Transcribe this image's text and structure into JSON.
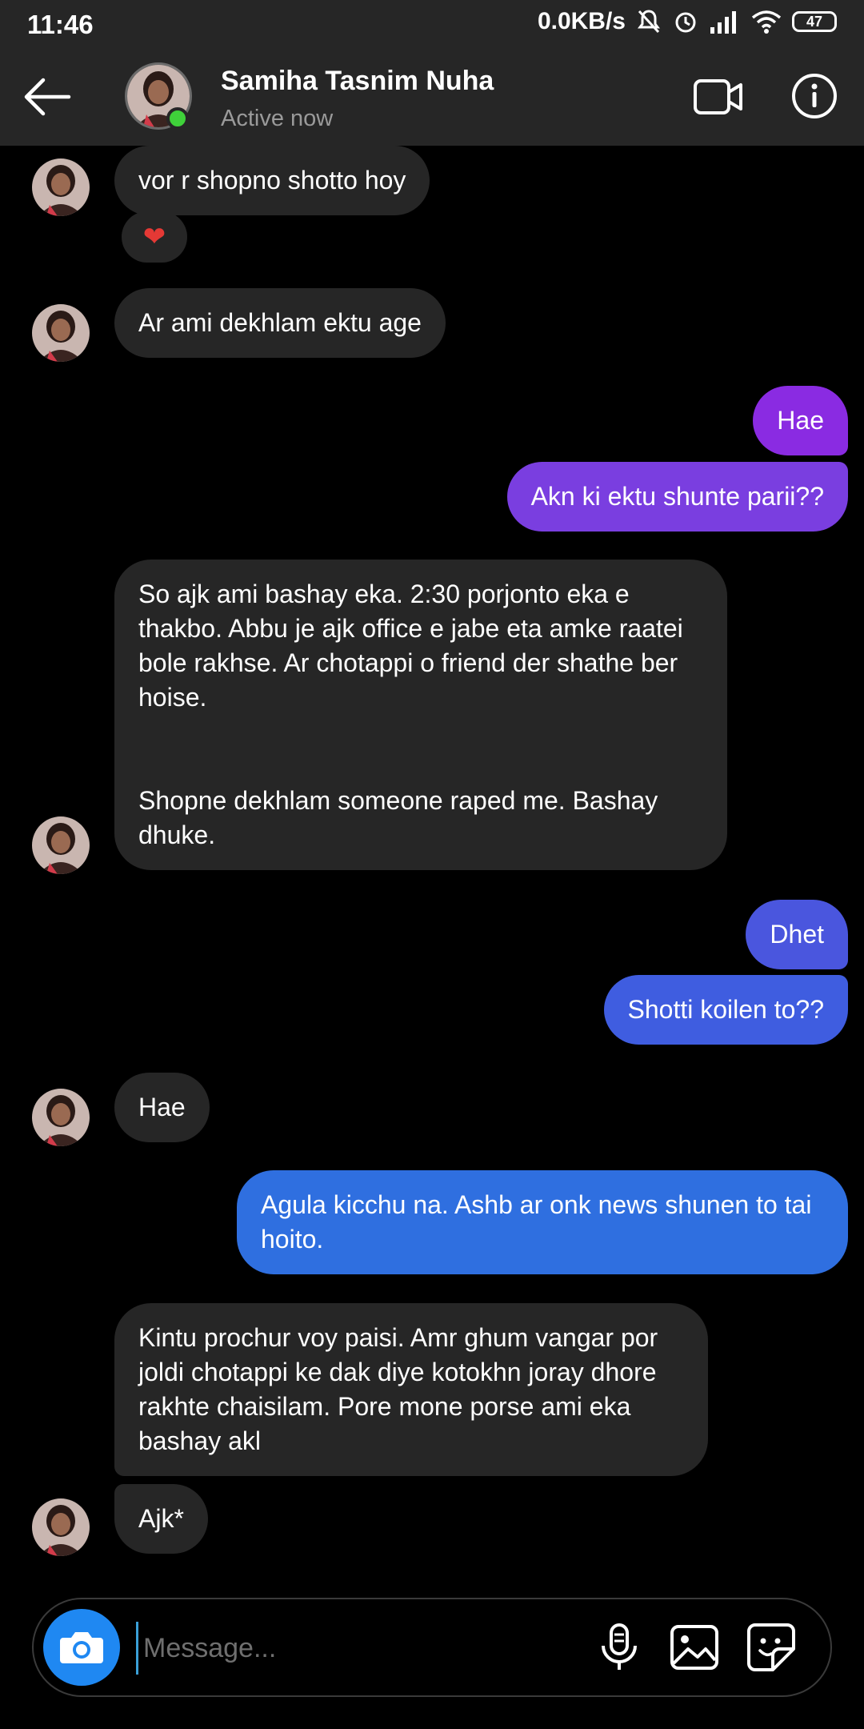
{
  "status_bar": {
    "time": "11:46",
    "speed": "0.0KB/s",
    "battery": "47"
  },
  "header": {
    "name": "Samiha Tasnim Nuha",
    "status": "Active now"
  },
  "messages": [
    {
      "side": "in",
      "text": "vor r shopno shotto hoy",
      "reaction": "❤"
    },
    {
      "side": "in",
      "text": "Ar ami dekhlam ektu age"
    },
    {
      "side": "out",
      "text": "Hae"
    },
    {
      "side": "out",
      "text": "Akn ki ektu shunte parii??"
    },
    {
      "side": "in",
      "text": "So ajk ami bashay eka. 2:30 porjonto eka e thakbo. Abbu je ajk office e jabe eta amke raatei bole rakhse. Ar chotappi o friend der shathe ber hoise.\n\n\nShopne dekhlam someone raped me. Bashay dhuke."
    },
    {
      "side": "out",
      "text": "Dhet"
    },
    {
      "side": "out",
      "text": "Shotti koilen to??"
    },
    {
      "side": "in",
      "text": "Hae"
    },
    {
      "side": "out",
      "text": "Agula kicchu na. Ashb ar onk news shunen to tai hoito."
    },
    {
      "side": "in",
      "text": "Kintu prochur voy paisi. Amr ghum vangar por joldi chotappi ke dak diye kotokhn joray dhore rakhte chaisilam. Pore mone porse ami eka bashay akl"
    },
    {
      "side": "in",
      "text": "Ajk*"
    }
  ],
  "composer": {
    "placeholder": "Message..."
  },
  "colors": {
    "background": "#000000",
    "incoming": "#262626",
    "outgoing_top": "#8a2be2",
    "outgoing_bottom": "#2f6fe0",
    "accent": "#1f88f2",
    "online": "#3fd13a"
  },
  "icons": [
    "back-arrow-icon",
    "video-camera-icon",
    "info-icon",
    "camera-icon",
    "microphone-icon",
    "gallery-icon",
    "sticker-icon",
    "heart-icon"
  ]
}
